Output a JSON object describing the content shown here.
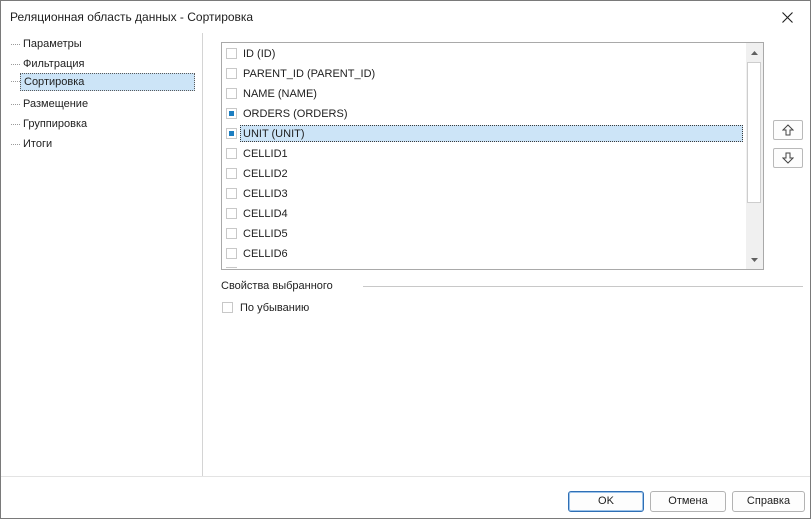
{
  "window": {
    "title": "Реляционная область данных - Сортировка"
  },
  "nav": {
    "items": [
      {
        "label": "Параметры"
      },
      {
        "label": "Фильтрация"
      },
      {
        "label": "Сортировка"
      },
      {
        "label": "Размещение"
      },
      {
        "label": "Группировка"
      },
      {
        "label": "Итоги"
      }
    ],
    "selected": "Сортировка"
  },
  "fields": {
    "items": [
      {
        "label": "ID (ID)",
        "checked": false
      },
      {
        "label": "PARENT_ID (PARENT_ID)",
        "checked": false
      },
      {
        "label": "NAME (NAME)",
        "checked": false
      },
      {
        "label": "ORDERS (ORDERS)",
        "checked": true
      },
      {
        "label": "UNIT (UNIT)",
        "checked": true
      },
      {
        "label": "CELLID1",
        "checked": false
      },
      {
        "label": "CELLID2",
        "checked": false
      },
      {
        "label": "CELLID3",
        "checked": false
      },
      {
        "label": "CELLID4",
        "checked": false
      },
      {
        "label": "CELLID5",
        "checked": false
      },
      {
        "label": "CELLID6",
        "checked": false
      }
    ],
    "selected": "UNIT (UNIT)"
  },
  "properties": {
    "title": "Свойства выбранного",
    "descending_label": "По убыванию",
    "descending_checked": false
  },
  "footer": {
    "ok_label": "OK",
    "cancel_label": "Отмена",
    "help_label": "Справка"
  },
  "colors": {
    "accent": "#1c7ec1",
    "selection": "#cce4f7",
    "border": "#a9a9a9"
  },
  "icons": {
    "close": "close-icon",
    "move_up": "arrow-up-icon",
    "move_down": "arrow-down-icon",
    "scroll_up": "scroll-up-icon",
    "scroll_down": "scroll-down-icon"
  }
}
